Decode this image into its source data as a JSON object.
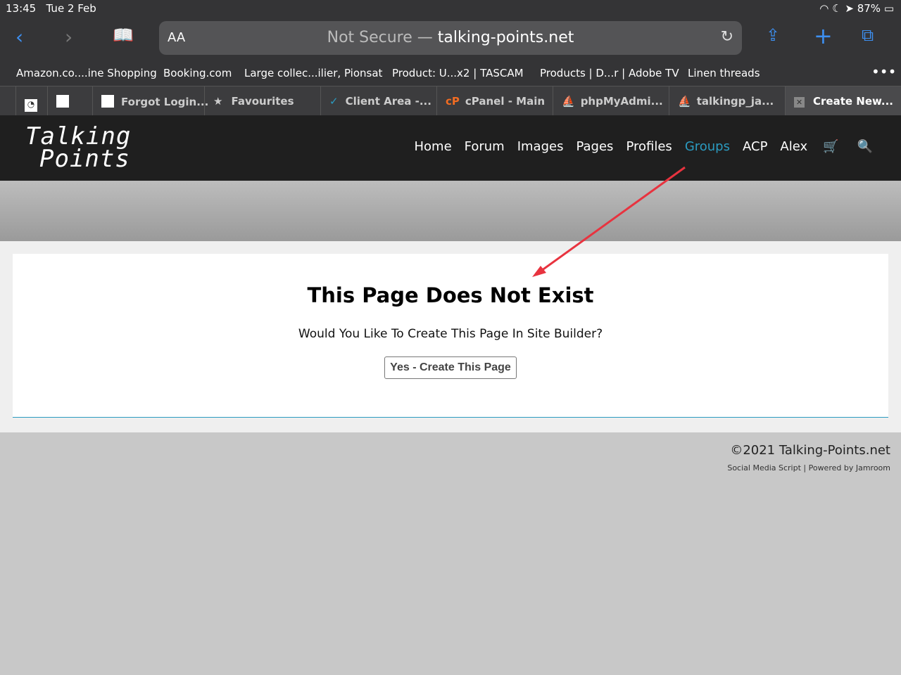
{
  "status": {
    "time": "13:45",
    "date": "Tue 2 Feb",
    "battery": "87%"
  },
  "browser": {
    "aa": "AA",
    "not_secure": "Not Secure —",
    "domain": "talking-points.net"
  },
  "bookmarks": [
    "Amazon.co....ine Shopping",
    "Booking.com",
    "Large collec...ilier, Pionsat",
    "Product: U...x2 | TASCAM",
    "Products | D...r | Adobe TV",
    "Linen threads"
  ],
  "tabs": [
    "Forgot Login...",
    "Favourites",
    "Client Area -...",
    "cPanel - Main",
    "phpMyAdmi...",
    "talkingp_ja...",
    "Create New..."
  ],
  "site": {
    "logo_line1": "Talking",
    "logo_line2": "Points",
    "nav": [
      "Home",
      "Forum",
      "Images",
      "Pages",
      "Profiles",
      "Groups",
      "ACP",
      "Alex"
    ],
    "active": "Groups",
    "accent": "#2b9bc0"
  },
  "main": {
    "title": "This Page Does Not Exist",
    "question": "Would You Like To Create This Page In Site Builder?",
    "button": "Yes - Create This Page"
  },
  "footer": {
    "copyright": "©2021 Talking-Points.net",
    "links": "Social Media Script | Powered by Jamroom"
  }
}
